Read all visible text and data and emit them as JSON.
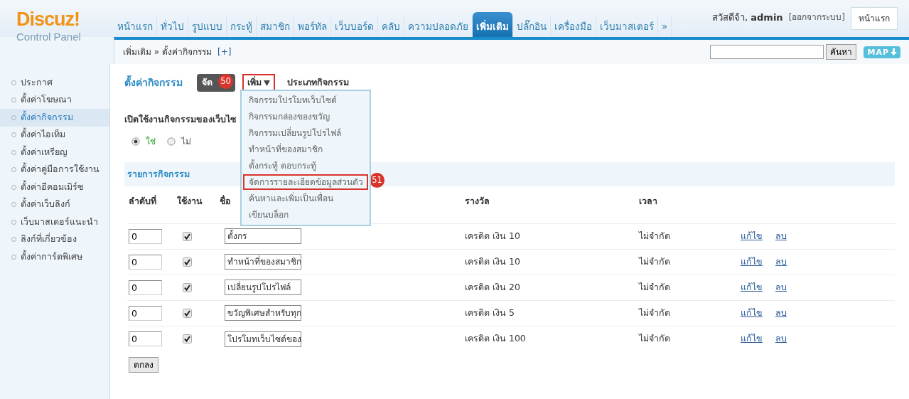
{
  "logo": {
    "title": "Discuz!",
    "subtitle": "Control Panel"
  },
  "nav": [
    {
      "label": "หน้าแรก",
      "selected": false
    },
    {
      "label": "ทั่วไป",
      "selected": false
    },
    {
      "label": "รูปแบบ",
      "selected": false
    },
    {
      "label": "กระทู้",
      "selected": false
    },
    {
      "label": "สมาชิก",
      "selected": false
    },
    {
      "label": "พอร์ทัล",
      "selected": false
    },
    {
      "label": "เว็บบอร์ด",
      "selected": false
    },
    {
      "label": "คลับ",
      "selected": false
    },
    {
      "label": "ความปลอดภัย",
      "selected": false
    },
    {
      "label": "เพิ่มเติม",
      "selected": true
    },
    {
      "label": "ปลั๊กอิน",
      "selected": false
    },
    {
      "label": "เครื่องมือ",
      "selected": false
    },
    {
      "label": "เว็บมาสเตอร์",
      "selected": false
    },
    {
      "label": "»",
      "selected": false
    }
  ],
  "user": {
    "greeting": "สวัสดีจ้า,",
    "name": "admin",
    "logout": "[ออกจากระบบ]",
    "home_button": "หน้าแรก"
  },
  "breadcrumb": {
    "path": "เพิ่มเติม » ตั้งค่ากิจกรรม",
    "add": "[+]"
  },
  "search": {
    "button": "คันหา"
  },
  "map_button": "MAP",
  "sidebar": {
    "items": [
      {
        "label": "ประกาศ",
        "selected": false
      },
      {
        "label": "ตั้งค่าโฆษณา",
        "selected": false
      },
      {
        "label": "ตั้งค่ากิจกรรม",
        "selected": true
      },
      {
        "label": "ตั้งค่าไอเท็ม",
        "selected": false
      },
      {
        "label": "ตั้งค่าเหรียญ",
        "selected": false
      },
      {
        "label": "ตั้งค่าคู่มือการใช้งาน",
        "selected": false
      },
      {
        "label": "ตั้งค่าอีคอมเมิร์ซ",
        "selected": false
      },
      {
        "label": "ตั้งค่าเว็บลิงก์",
        "selected": false
      },
      {
        "label": "เว็บมาสเตอร์แนะนำ",
        "selected": false
      },
      {
        "label": "ลิงก์ที่เกี่ยวข้อง",
        "selected": false
      },
      {
        "label": "ตั้งค่าการ์ดพิเศษ",
        "selected": false
      }
    ]
  },
  "page_title": "ตั้งค่ากิจกรรม",
  "toolbar": [
    {
      "label": "จัด",
      "selected": true,
      "dropdown": false,
      "highlighted": false,
      "annotation": "50"
    },
    {
      "label": "เพิ่ม",
      "selected": false,
      "dropdown": true,
      "highlighted": true
    },
    {
      "label": "ประเภทกิจกรรม",
      "selected": false,
      "dropdown": false,
      "highlighted": false
    }
  ],
  "dropdown_menu": [
    {
      "label": "กิจกรรมโปรโมทเว็บไซต์",
      "highlighted": false
    },
    {
      "label": "กิจกรรมกล่องของขวัญ",
      "highlighted": false
    },
    {
      "label": "กิจกรรมเปลี่ยนรูปโปรไฟล์",
      "highlighted": false
    },
    {
      "label": "ทำหน้าที่ของสมาชิก",
      "highlighted": false
    },
    {
      "label": "ตั้งกระทู้ ตอบกระทู้",
      "highlighted": false
    },
    {
      "label": "จัดการรายละเอียดข้อมูลส่วนตัว",
      "highlighted": true,
      "annotation": "51"
    },
    {
      "label": "ค้นหาและเพิ่มเป็นเพื่อน",
      "highlighted": false
    },
    {
      "label": "เขียนบล็อก",
      "highlighted": false
    }
  ],
  "setting": {
    "label": "เปิดใช้งานกิจกรรมของเว็บไซ",
    "options": [
      {
        "label": "ใช่",
        "selected": true
      },
      {
        "label": "ไม่",
        "selected": false
      }
    ]
  },
  "section_title": "รายการกิจกรรม",
  "table": {
    "columns": [
      "ลำดับที่",
      "ใช้งาน",
      "ชื่อ",
      "รางวัล",
      "เวลา"
    ],
    "rows": [
      {
        "order": "0",
        "enabled": true,
        "name": "ตั้งกร",
        "reward": "เครดิต เงิน 10",
        "time": "ไม่จำกัด",
        "actions": [
          "แก้ไข",
          "ลบ"
        ]
      },
      {
        "order": "0",
        "enabled": true,
        "name": "ทำหน้าที่ของสมาชิก",
        "reward": "เครดิต เงิน 10",
        "time": "ไม่จำกัด",
        "actions": [
          "แก้ไข",
          "ลบ"
        ]
      },
      {
        "order": "0",
        "enabled": true,
        "name": "เปลี่ยนรูปโปรไฟล์",
        "reward": "เครดิต เงิน 20",
        "time": "ไม่จำกัด",
        "actions": [
          "แก้ไข",
          "ลบ"
        ]
      },
      {
        "order": "0",
        "enabled": true,
        "name": "ขวัญพิเศษสำหรับทุก",
        "reward": "เครดิต เงิน 5",
        "time": "ไม่จำกัด",
        "actions": [
          "แก้ไข",
          "ลบ"
        ]
      },
      {
        "order": "0",
        "enabled": true,
        "name": "โปรโมทเว็บไซต์ของ",
        "reward": "เครดิต เงิน 100",
        "time": "ไม่จำกัด",
        "actions": [
          "แก้ไข",
          "ลบ"
        ]
      }
    ]
  },
  "submit_button": "ตกลง"
}
